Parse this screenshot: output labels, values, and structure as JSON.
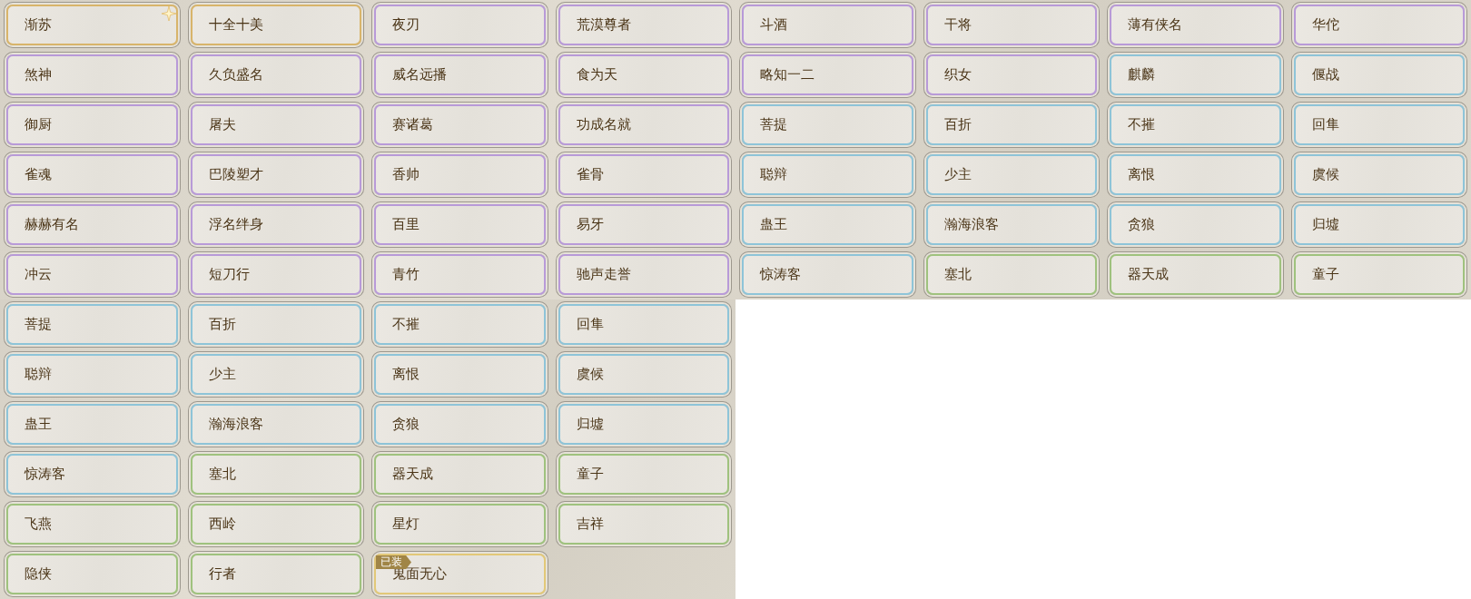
{
  "sections": [
    {
      "kind": "wide",
      "items": [
        {
          "name": "渐苏",
          "color": "#d8b46a",
          "sparkle": true
        },
        {
          "name": "十全十美",
          "color": "#d8b46a"
        },
        {
          "name": "夜刃",
          "color": "#b89ad8"
        },
        {
          "name": "荒漠尊者",
          "color": "#b89ad8"
        },
        {
          "name": "斗酒",
          "color": "#b89ad8"
        },
        {
          "name": "干将",
          "color": "#b89ad8"
        },
        {
          "name": "薄有侠名",
          "color": "#b89ad8"
        },
        {
          "name": "华佗",
          "color": "#b89ad8"
        },
        {
          "name": "煞神",
          "color": "#b89ad8"
        },
        {
          "name": "久负盛名",
          "color": "#b89ad8"
        },
        {
          "name": "威名远播",
          "color": "#b89ad8"
        },
        {
          "name": "食为天",
          "color": "#b89ad8"
        },
        {
          "name": "略知一二",
          "color": "#b89ad8"
        },
        {
          "name": "织女",
          "color": "#b89ad8"
        },
        {
          "name": "麒麟",
          "color": "#8ec4d8"
        },
        {
          "name": "偃战",
          "color": "#8ec4d8"
        },
        {
          "name": "御厨",
          "color": "#b89ad8"
        },
        {
          "name": "屠夫",
          "color": "#b89ad8"
        },
        {
          "name": "赛诸葛",
          "color": "#b89ad8"
        },
        {
          "name": "功成名就",
          "color": "#b89ad8"
        },
        {
          "name": "菩提",
          "color": "#8ec4d8"
        },
        {
          "name": "百折",
          "color": "#8ec4d8"
        },
        {
          "name": "不摧",
          "color": "#8ec4d8"
        },
        {
          "name": "回隼",
          "color": "#8ec4d8"
        },
        {
          "name": "雀魂",
          "color": "#b89ad8"
        },
        {
          "name": "巴陵塑才",
          "color": "#b89ad8"
        },
        {
          "name": "香帅",
          "color": "#b89ad8"
        },
        {
          "name": "雀骨",
          "color": "#b89ad8"
        },
        {
          "name": "聪辩",
          "color": "#8ec4d8"
        },
        {
          "name": "少主",
          "color": "#8ec4d8"
        },
        {
          "name": "离恨",
          "color": "#8ec4d8"
        },
        {
          "name": "虞候",
          "color": "#8ec4d8"
        },
        {
          "name": "赫赫有名",
          "color": "#b89ad8"
        },
        {
          "name": "浮名绊身",
          "color": "#b89ad8"
        },
        {
          "name": "百里",
          "color": "#b89ad8"
        },
        {
          "name": "易牙",
          "color": "#b89ad8"
        },
        {
          "name": "蛊王",
          "color": "#8ec4d8"
        },
        {
          "name": "瀚海浪客",
          "color": "#8ec4d8"
        },
        {
          "name": "贪狼",
          "color": "#8ec4d8"
        },
        {
          "name": "归墟",
          "color": "#8ec4d8"
        },
        {
          "name": "冲云",
          "color": "#b89ad8"
        },
        {
          "name": "短刀行",
          "color": "#b89ad8"
        },
        {
          "name": "青竹",
          "color": "#b89ad8"
        },
        {
          "name": "驰声走誉",
          "color": "#b89ad8"
        },
        {
          "name": "惊涛客",
          "color": "#8ec4d8"
        },
        {
          "name": "塞北",
          "color": "#9fc27e"
        },
        {
          "name": "器天成",
          "color": "#9fc27e"
        },
        {
          "name": "童子",
          "color": "#9fc27e"
        }
      ]
    },
    {
      "kind": "narrow",
      "items": [
        {
          "name": "菩提",
          "color": "#8ec4d8"
        },
        {
          "name": "百折",
          "color": "#8ec4d8"
        },
        {
          "name": "不摧",
          "color": "#8ec4d8"
        },
        {
          "name": "回隼",
          "color": "#8ec4d8"
        },
        {
          "name": "聪辩",
          "color": "#8ec4d8"
        },
        {
          "name": "少主",
          "color": "#8ec4d8"
        },
        {
          "name": "离恨",
          "color": "#8ec4d8"
        },
        {
          "name": "虞候",
          "color": "#8ec4d8"
        },
        {
          "name": "蛊王",
          "color": "#8ec4d8"
        },
        {
          "name": "瀚海浪客",
          "color": "#8ec4d8"
        },
        {
          "name": "贪狼",
          "color": "#8ec4d8"
        },
        {
          "name": "归墟",
          "color": "#8ec4d8"
        },
        {
          "name": "惊涛客",
          "color": "#8ec4d8"
        },
        {
          "name": "塞北",
          "color": "#9fc27e"
        },
        {
          "name": "器天成",
          "color": "#9fc27e"
        },
        {
          "name": "童子",
          "color": "#9fc27e"
        },
        {
          "name": "飞燕",
          "color": "#9fc27e"
        },
        {
          "name": "西岭",
          "color": "#9fc27e"
        },
        {
          "name": "星灯",
          "color": "#9fc27e"
        },
        {
          "name": "吉祥",
          "color": "#9fc27e"
        },
        {
          "name": "隐侠",
          "color": "#9fc27e"
        },
        {
          "name": "行者",
          "color": "#9fc27e"
        },
        {
          "name": "鬼面无心",
          "color": "#e2c878",
          "badge": "已装"
        }
      ]
    }
  ]
}
